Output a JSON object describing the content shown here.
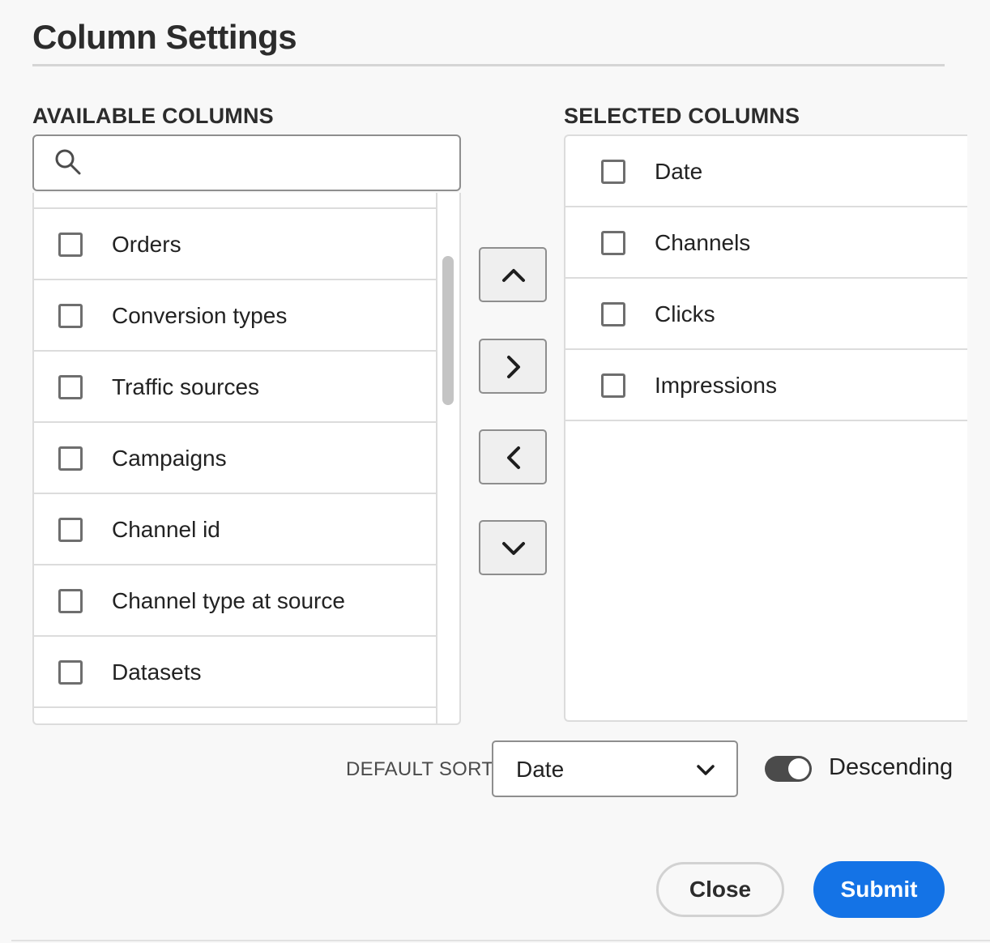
{
  "dialog": {
    "title": "Column Settings"
  },
  "available": {
    "heading": "AVAILABLE COLUMNS",
    "search": {
      "value": "",
      "placeholder": "",
      "icon": "search-icon"
    },
    "items": [
      {
        "label": "Orders",
        "checked": false
      },
      {
        "label": "Conversion types",
        "checked": false
      },
      {
        "label": "Traffic sources",
        "checked": false
      },
      {
        "label": "Campaigns",
        "checked": false
      },
      {
        "label": "Channel id",
        "checked": false
      },
      {
        "label": "Channel type at source",
        "checked": false
      },
      {
        "label": "Datasets",
        "checked": false
      }
    ]
  },
  "move_buttons": [
    {
      "name": "move-up-button",
      "icon": "chevron-up-icon"
    },
    {
      "name": "add-to-selected-button",
      "icon": "chevron-right-icon"
    },
    {
      "name": "remove-from-selected-button",
      "icon": "chevron-left-icon"
    },
    {
      "name": "move-down-button",
      "icon": "chevron-down-icon"
    }
  ],
  "selected": {
    "heading": "SELECTED COLUMNS",
    "items": [
      {
        "label": "Date",
        "checked": false
      },
      {
        "label": "Channels",
        "checked": false
      },
      {
        "label": "Clicks",
        "checked": false
      },
      {
        "label": "Impressions",
        "checked": false
      }
    ]
  },
  "sort": {
    "label": "DEFAULT SORT",
    "selected": "Date",
    "descending_label": "Descending",
    "descending_on": true
  },
  "footer": {
    "close_label": "Close",
    "submit_label": "Submit"
  },
  "colors": {
    "accent": "#1473e6",
    "toggle_on": "#4b4b4b",
    "background": "#f8f8f8"
  }
}
